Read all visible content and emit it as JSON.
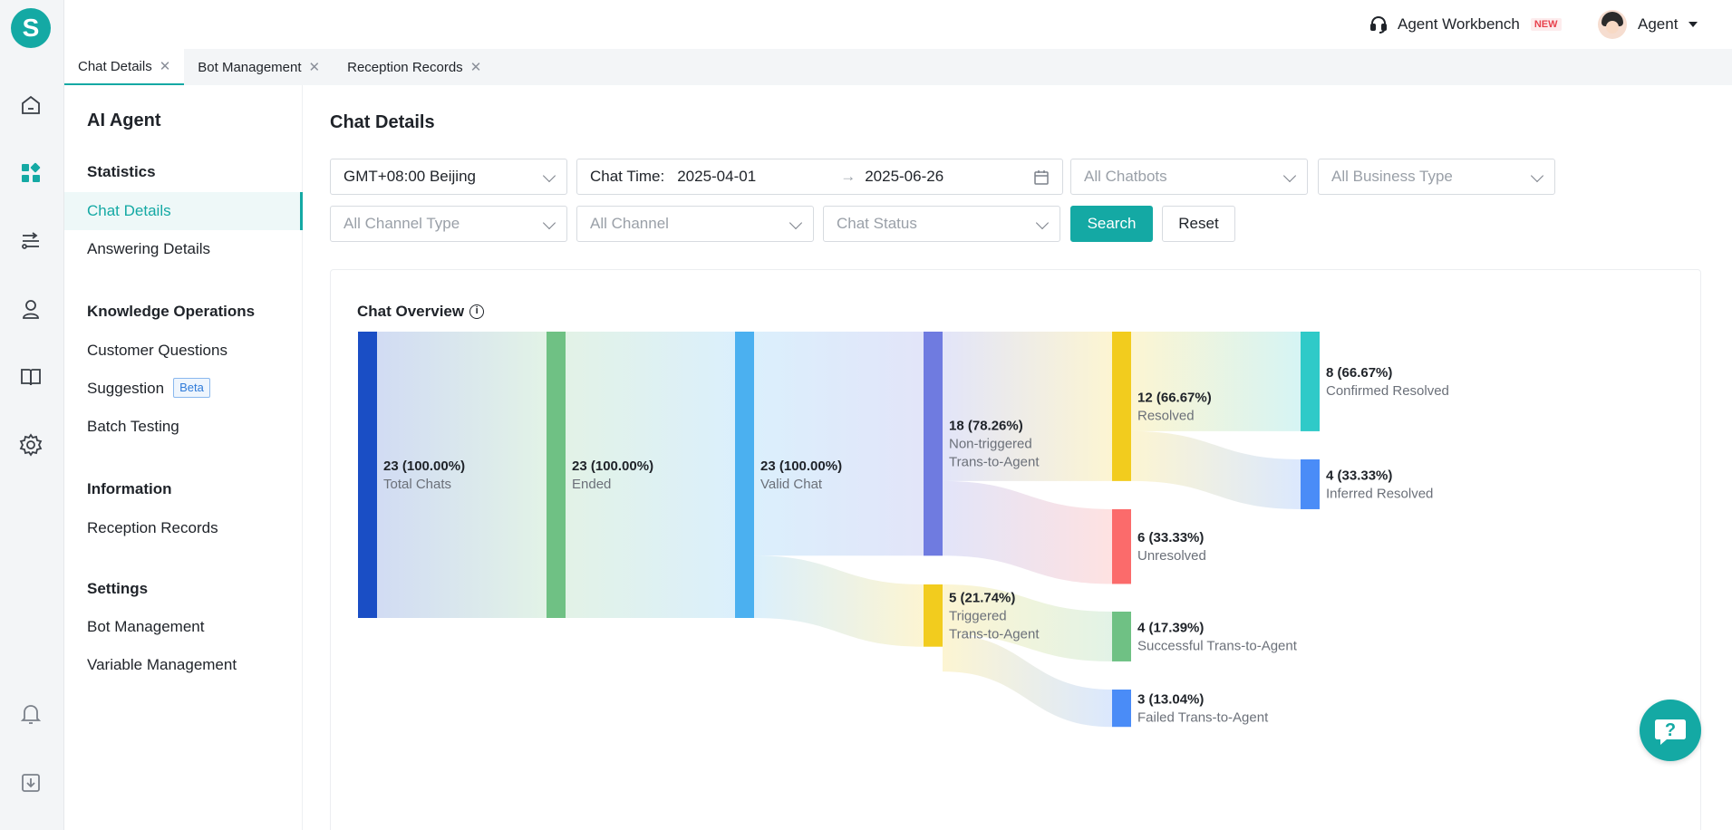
{
  "app": {
    "logo_letter": "S"
  },
  "rail": {
    "icons": [
      "home-icon",
      "dashboard-icon",
      "flow-icon",
      "agent-icon",
      "book-icon",
      "gear-icon",
      "bell-icon",
      "download-icon"
    ]
  },
  "header": {
    "workbench_label": "Agent Workbench",
    "new_badge": "NEW",
    "user_name": "Agent"
  },
  "tabs": [
    {
      "label": "Chat Details",
      "active": true
    },
    {
      "label": "Bot Management"
    },
    {
      "label": "Reception Records"
    }
  ],
  "sidebar": {
    "title": "AI Agent",
    "groups": [
      {
        "label": "Statistics",
        "items": [
          {
            "label": "Chat Details",
            "active": true
          },
          {
            "label": "Answering Details"
          }
        ]
      },
      {
        "label": "Knowledge Operations",
        "items": [
          {
            "label": "Customer Questions"
          },
          {
            "label": "Suggestion",
            "badge": "Beta"
          },
          {
            "label": "Batch Testing"
          }
        ]
      },
      {
        "label": "Information",
        "items": [
          {
            "label": "Reception Records"
          }
        ]
      },
      {
        "label": "Settings",
        "items": [
          {
            "label": "Bot Management"
          },
          {
            "label": "Variable Management"
          }
        ]
      }
    ]
  },
  "page": {
    "title": "Chat Details"
  },
  "filters": {
    "timezone": "GMT+08:00 Beijing",
    "chat_time_label": "Chat Time:",
    "date_start": "2025-04-01",
    "date_end": "2025-06-26",
    "chatbots_placeholder": "All Chatbots",
    "business_type_placeholder": "All Business Type",
    "channel_type_placeholder": "All Channel Type",
    "channel_placeholder": "All Channel",
    "chat_status_placeholder": "Chat Status",
    "search_label": "Search",
    "reset_label": "Reset"
  },
  "overview": {
    "title": "Chat Overview"
  },
  "chart_data": {
    "type": "sankey",
    "nodes": [
      {
        "id": "total",
        "value_text": "23 (100.00%)",
        "label": [
          "Total Chats"
        ],
        "value": 23,
        "color": "#1a4ec5"
      },
      {
        "id": "ended",
        "value_text": "23 (100.00%)",
        "label": [
          "Ended"
        ],
        "value": 23,
        "color": "#6fc184"
      },
      {
        "id": "valid",
        "value_text": "23 (100.00%)",
        "label": [
          "Valid Chat"
        ],
        "value": 23,
        "color": "#4bb0f0"
      },
      {
        "id": "nontrig",
        "value_text": "18 (78.26%)",
        "label": [
          "Non-triggered",
          "Trans-to-Agent"
        ],
        "value": 18,
        "color": "#6f7be0"
      },
      {
        "id": "trig",
        "value_text": "5 (21.74%)",
        "label": [
          "Triggered",
          "Trans-to-Agent"
        ],
        "value": 5,
        "color": "#f2cc1e"
      },
      {
        "id": "resolved",
        "value_text": "12 (66.67%)",
        "label": [
          "Resolved"
        ],
        "value": 12,
        "color": "#f2cc1e"
      },
      {
        "id": "unresolved",
        "value_text": "6 (33.33%)",
        "label": [
          "Unresolved"
        ],
        "value": 6,
        "color": "#fb6b6b"
      },
      {
        "id": "success",
        "value_text": "4 (17.39%)",
        "label": [
          "Successful Trans-to-Agent"
        ],
        "value": 4,
        "color": "#6fc184"
      },
      {
        "id": "failed",
        "value_text": "3 (13.04%)",
        "label": [
          "Failed Trans-to-Agent"
        ],
        "value": 3,
        "color": "#4a8cf7"
      },
      {
        "id": "confirmed",
        "value_text": "8 (66.67%)",
        "label": [
          "Confirmed Resolved"
        ],
        "value": 8,
        "color": "#2fcac8"
      },
      {
        "id": "inferred",
        "value_text": "4 (33.33%)",
        "label": [
          "Inferred Resolved"
        ],
        "value": 4,
        "color": "#4a8cf7"
      }
    ],
    "links": [
      {
        "source": "total",
        "target": "ended",
        "value": 23
      },
      {
        "source": "ended",
        "target": "valid",
        "value": 23
      },
      {
        "source": "valid",
        "target": "nontrig",
        "value": 18
      },
      {
        "source": "valid",
        "target": "trig",
        "value": 5
      },
      {
        "source": "nontrig",
        "target": "resolved",
        "value": 12
      },
      {
        "source": "nontrig",
        "target": "unresolved",
        "value": 6
      },
      {
        "source": "trig",
        "target": "success",
        "value": 4
      },
      {
        "source": "trig",
        "target": "failed",
        "value": 3
      },
      {
        "source": "resolved",
        "target": "confirmed",
        "value": 8
      },
      {
        "source": "resolved",
        "target": "inferred",
        "value": 4
      }
    ]
  },
  "help": {
    "glyph": "?"
  }
}
